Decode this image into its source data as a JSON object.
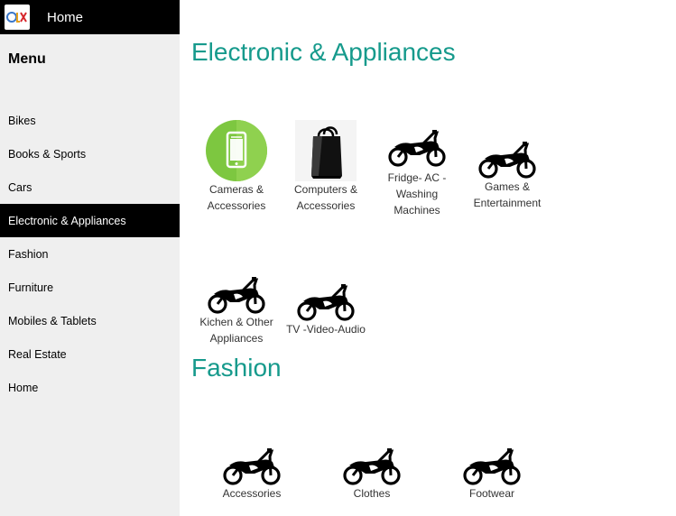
{
  "header": {
    "title": "Home",
    "logo_icon": "olx-logo"
  },
  "sidebar": {
    "heading": "Menu",
    "active_index": 3,
    "items": [
      {
        "label": "Bikes"
      },
      {
        "label": "Books & Sports"
      },
      {
        "label": "Cars"
      },
      {
        "label": "Electronic & Appliances"
      },
      {
        "label": "Fashion"
      },
      {
        "label": "Furniture"
      },
      {
        "label": "Mobiles & Tablets"
      },
      {
        "label": "Real Estate"
      },
      {
        "label": "Home"
      }
    ]
  },
  "sections": [
    {
      "title": "Electronic & Appliances",
      "tiles": [
        {
          "label": "Cameras & Accessories",
          "icon": "phone-icon"
        },
        {
          "label": "Computers & Accessories",
          "icon": "shopping-bag-icon"
        },
        {
          "label": "Fridge- AC -Washing Machines",
          "icon": "motorbike-icon"
        },
        {
          "label": "Games & Entertainment",
          "icon": "motorbike-icon"
        },
        {
          "label": "Kichen & Other Appliances",
          "icon": "motorbike-icon"
        },
        {
          "label": "TV -Video-Audio",
          "icon": "motorbike-icon"
        }
      ]
    },
    {
      "title": "Fashion",
      "tiles": [
        {
          "label": "Accessories",
          "icon": "motorbike-icon"
        },
        {
          "label": "Clothes",
          "icon": "motorbike-icon"
        },
        {
          "label": "Footwear",
          "icon": "motorbike-icon"
        }
      ]
    }
  ],
  "colors": {
    "accent": "#169a8c",
    "sidebar_bg": "#efefef",
    "topbar_bg": "#000000"
  }
}
